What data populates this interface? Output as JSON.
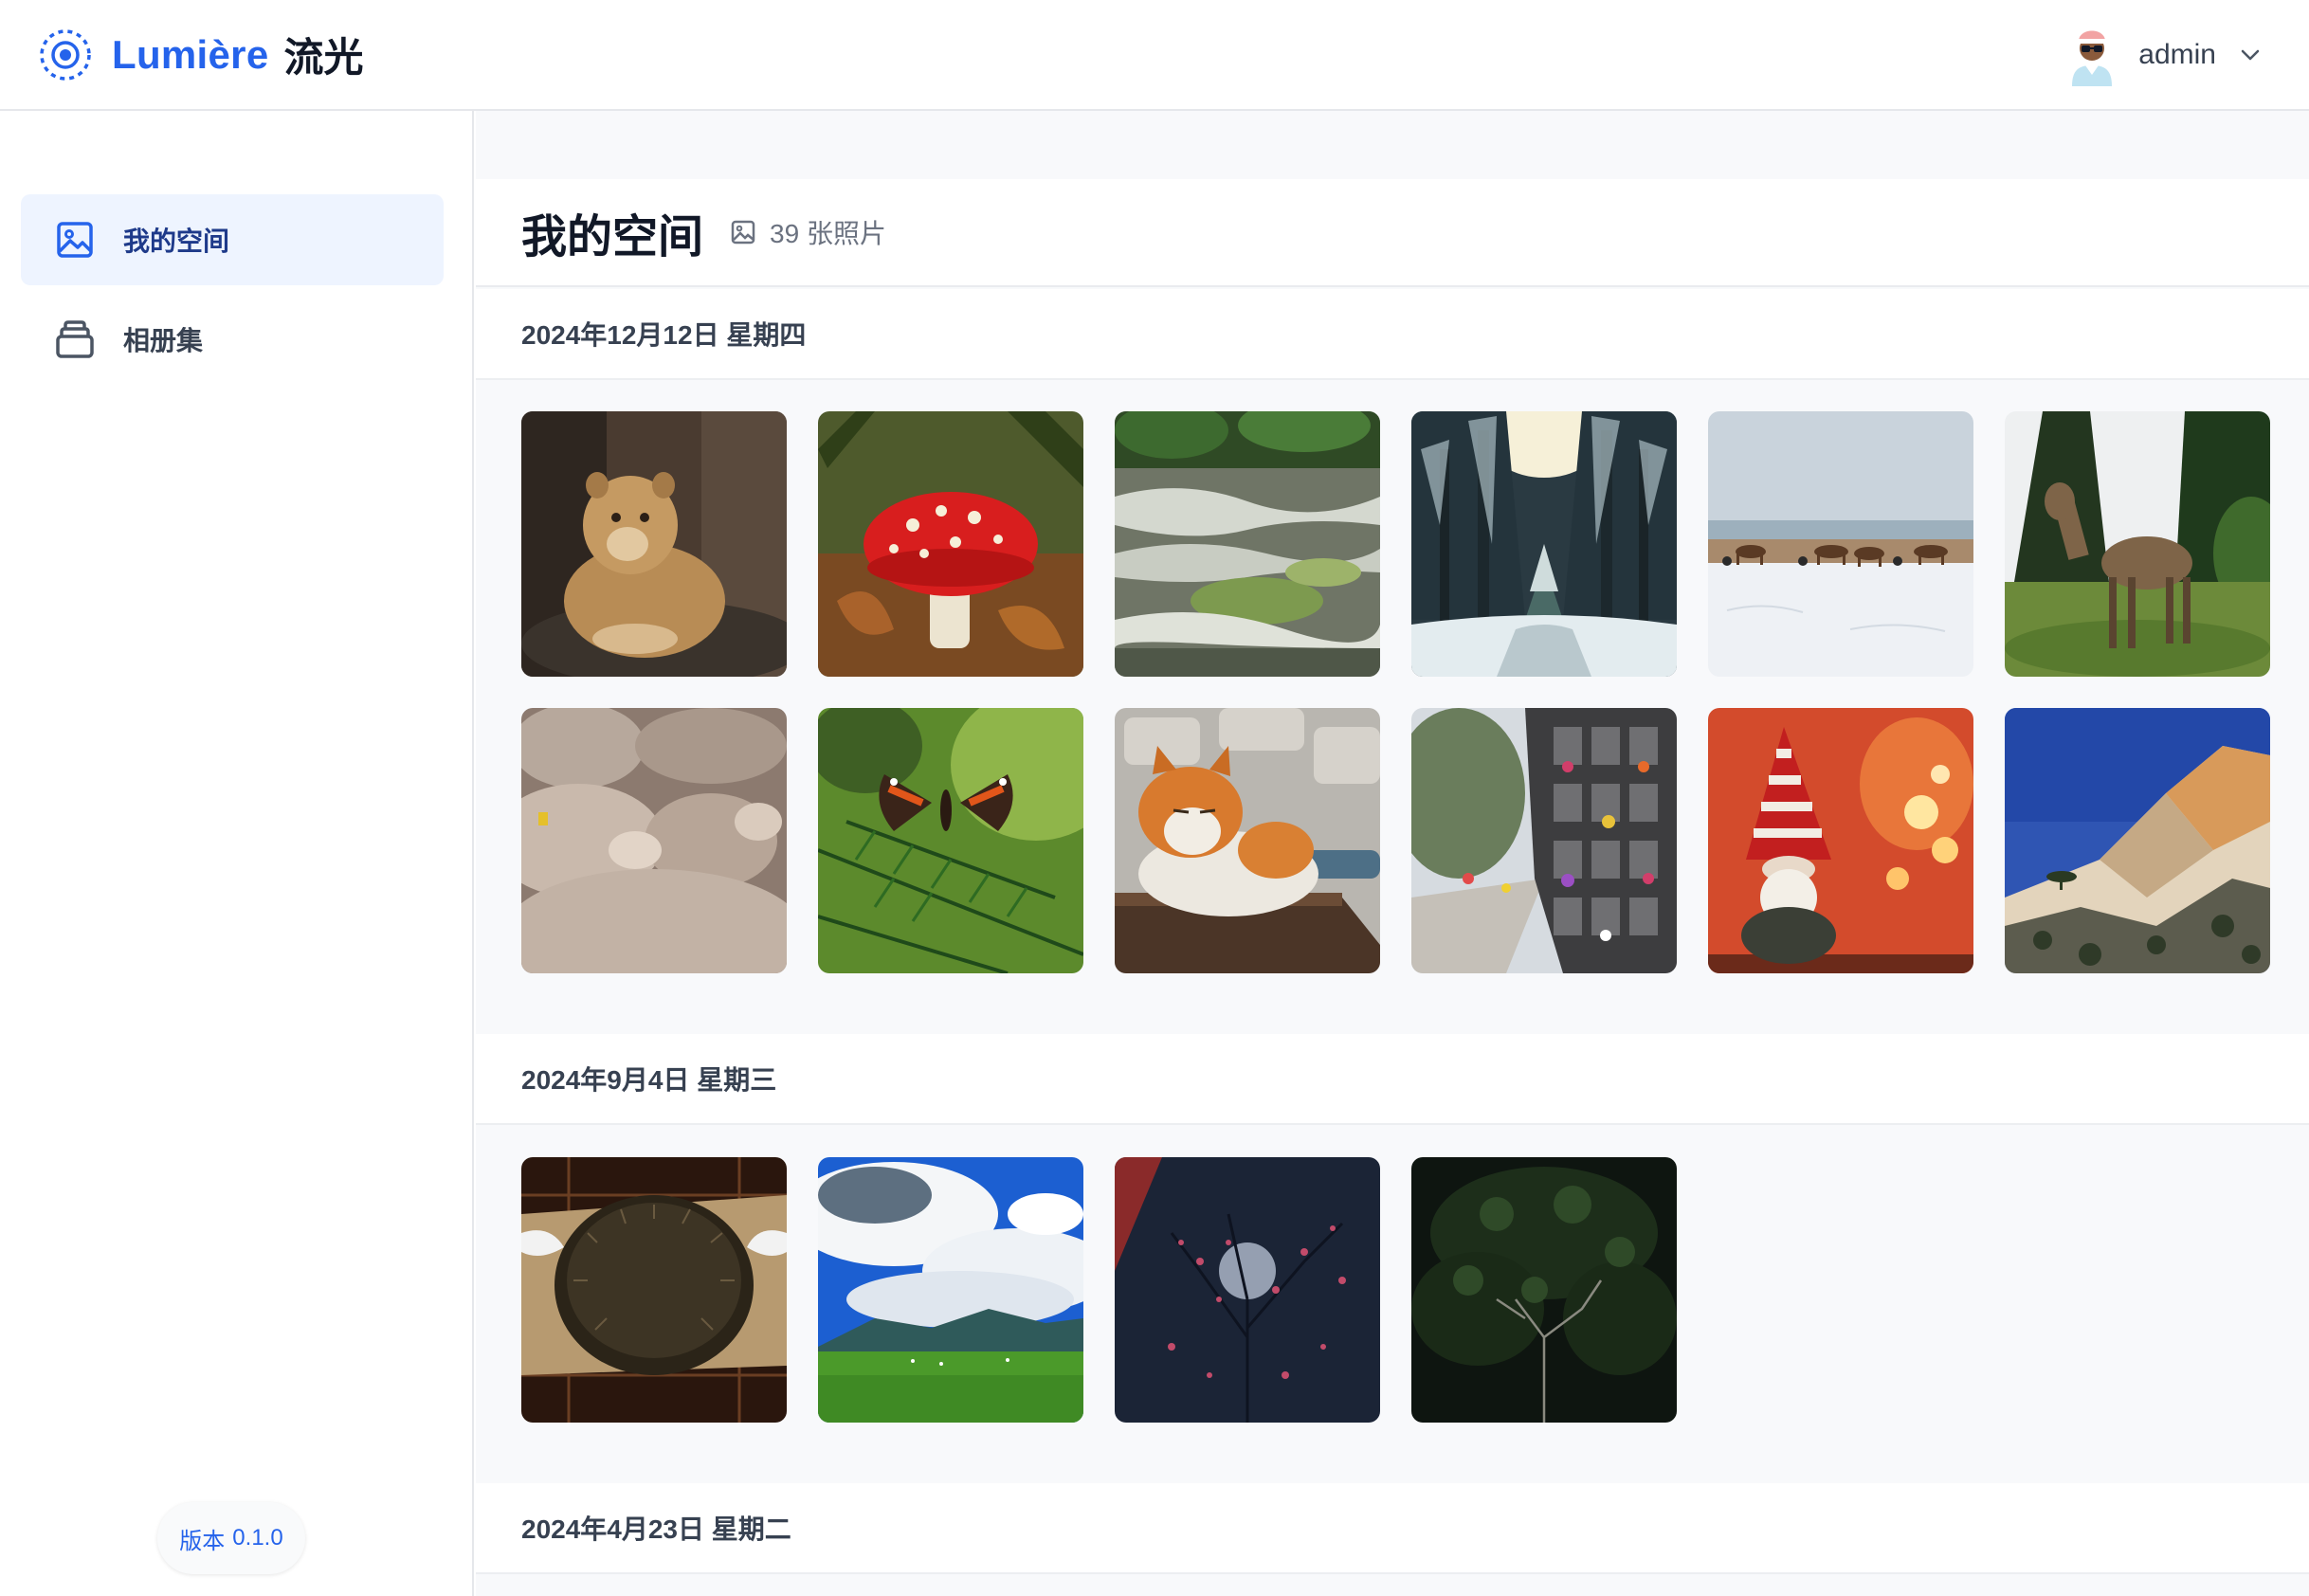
{
  "app": {
    "brand_name": "Lumière",
    "brand_cn": "流光"
  },
  "user": {
    "name": "admin"
  },
  "sidebar": {
    "items": [
      {
        "label": "我的空间",
        "icon": "image-icon",
        "active": true
      },
      {
        "label": "相册集",
        "icon": "album-stack-icon",
        "active": false
      }
    ],
    "version_label": "版本",
    "version_number": "0.1.0"
  },
  "main": {
    "title": "我的空间",
    "photo_count": "39 张照片",
    "groups": [
      {
        "date": "2024年12月12日 星期四",
        "photos": [
          "lioness",
          "fly-agaric-mushroom",
          "forest-stream",
          "snowy-forest-path",
          "harness-racing-on-snow",
          "deer-in-meadow",
          "sheep-flock",
          "red-admiral-butterfly",
          "ginger-white-cat",
          "cemetery-niches-with-flowers",
          "christmas-gnome",
          "coastal-cliff"
        ]
      },
      {
        "date": "2024年9月4日 星期三",
        "photos": [
          "hedgehog-sculpture",
          "blue-sky-clouds-volcano",
          "blossom-tree-at-night",
          "dark-pine-tree"
        ]
      },
      {
        "date": "2024年4月23日 星期二",
        "photos": []
      }
    ]
  },
  "colors": {
    "accent": "#2563eb",
    "active_nav_bg": "#eef4ff",
    "main_bg": "#f8f9fb"
  }
}
